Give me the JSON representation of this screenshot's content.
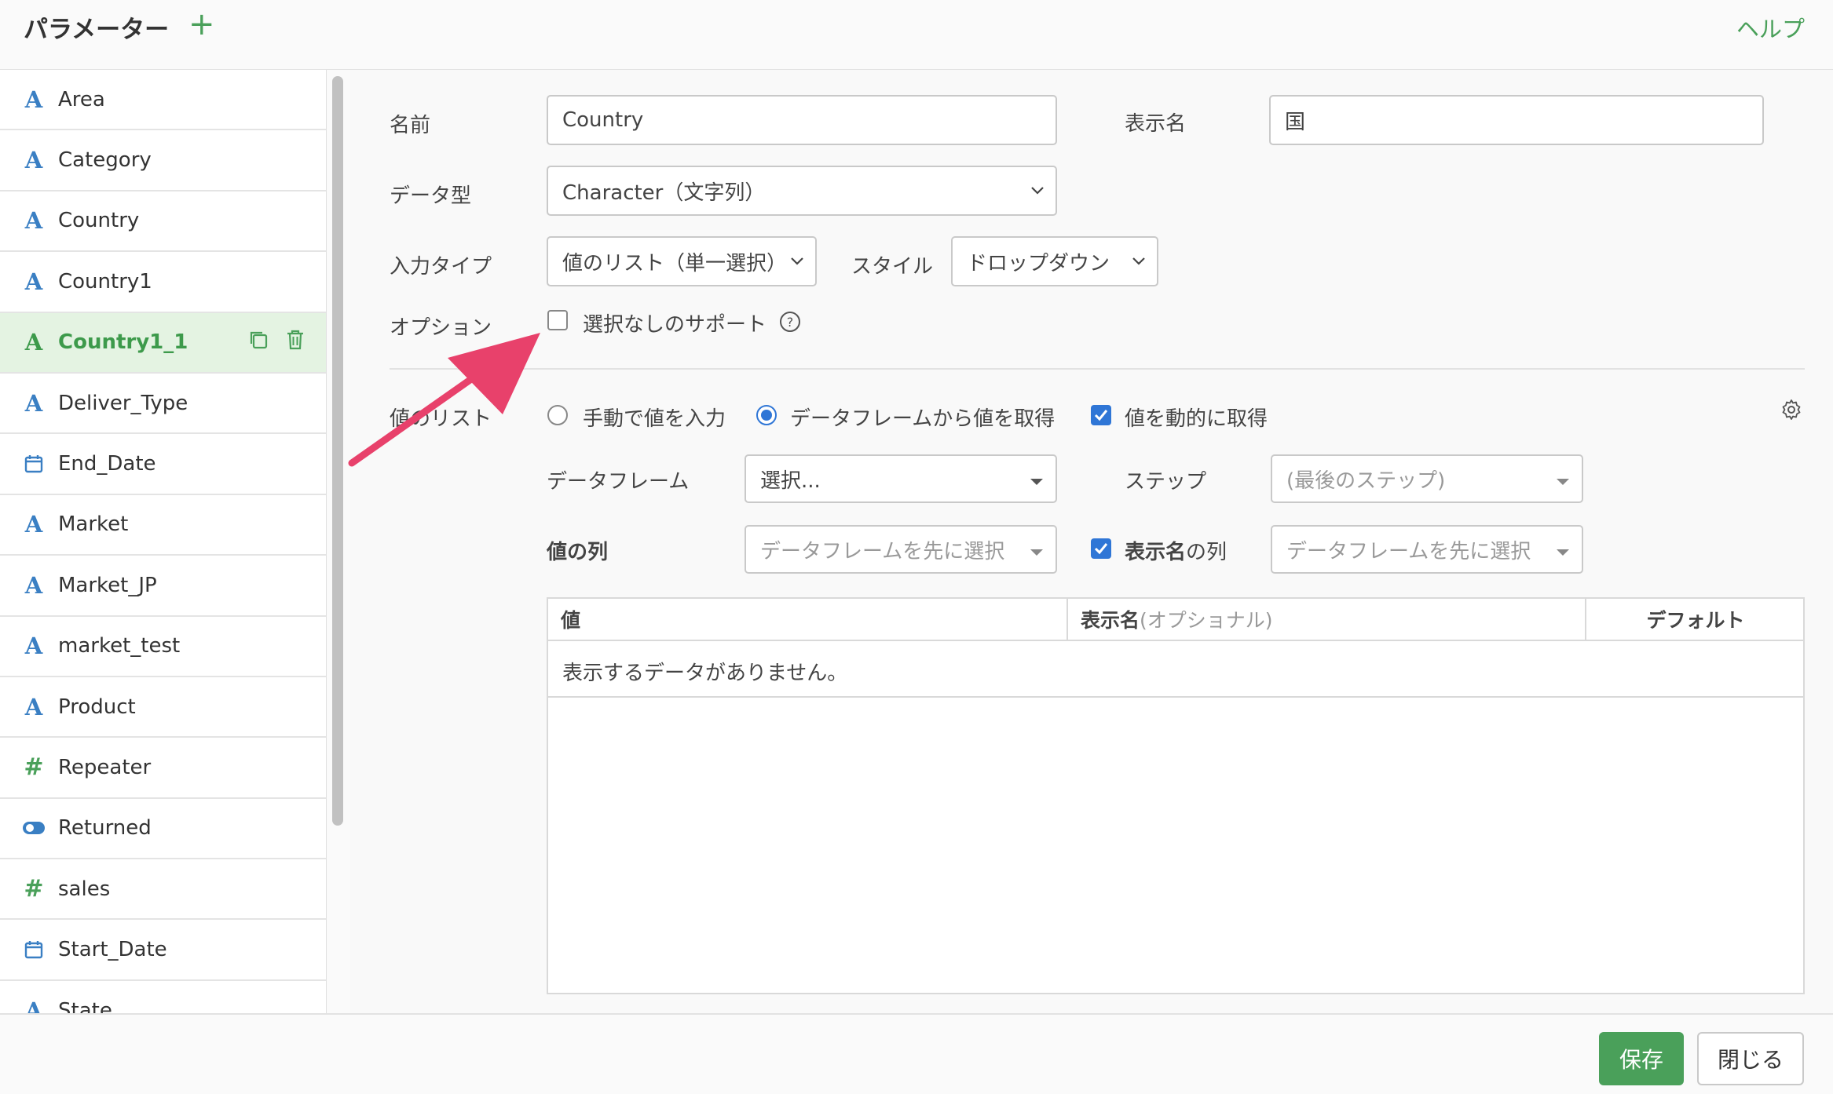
{
  "header": {
    "title": "パラメーター",
    "add_icon": "plus-icon",
    "help": "ヘルプ"
  },
  "sidebar": {
    "items": [
      {
        "label": "Area",
        "icon": "text-type-icon"
      },
      {
        "label": "Category",
        "icon": "text-type-icon"
      },
      {
        "label": "Country",
        "icon": "text-type-icon"
      },
      {
        "label": "Country1",
        "icon": "text-type-icon"
      },
      {
        "label": "Country1_1",
        "icon": "text-type-icon",
        "active": true
      },
      {
        "label": "Deliver_Type",
        "icon": "text-type-icon"
      },
      {
        "label": "End_Date",
        "icon": "calendar-icon"
      },
      {
        "label": "Market",
        "icon": "text-type-icon"
      },
      {
        "label": "Market_JP",
        "icon": "text-type-icon"
      },
      {
        "label": "market_test",
        "icon": "text-type-icon"
      },
      {
        "label": "Product",
        "icon": "text-type-icon"
      },
      {
        "label": "Repeater",
        "icon": "number-type-icon"
      },
      {
        "label": "Returned",
        "icon": "toggle-icon"
      },
      {
        "label": "sales",
        "icon": "number-type-icon"
      },
      {
        "label": "Start_Date",
        "icon": "calendar-icon"
      },
      {
        "label": "State",
        "icon": "text-type-icon"
      }
    ]
  },
  "form": {
    "name_label": "名前",
    "name_value": "Country",
    "display_label": "表示名",
    "display_value": "国",
    "datatype_label": "データ型",
    "datatype_value": "Character（文字列）",
    "inputtype_label": "入力タイプ",
    "inputtype_value": "値のリスト（単一選択）",
    "style_label": "スタイル",
    "style_value": "ドロップダウン",
    "option_label": "オプション",
    "option_text": "選択なしのサポート",
    "option_checked": false,
    "valuelist_label": "値のリスト",
    "radio_manual": "手動で値を入力",
    "radio_dataframe": "データフレームから値を取得",
    "radio_selected": "dataframe",
    "dynamic_label": "値を動的に取得",
    "dynamic_checked": true,
    "dataframe_label": "データフレーム",
    "dataframe_value": "選択...",
    "step_label": "ステップ",
    "step_placeholder": "(最後のステップ)",
    "valuecol_label": "値の列",
    "valuecol_placeholder": "データフレームを先に選択",
    "displaycol_label_bold": "表示名",
    "displaycol_label_rest": "の列",
    "displaycol_checked": true,
    "displaycol_placeholder": "データフレームを先に選択"
  },
  "table": {
    "col_value": "値",
    "col_display": "表示名",
    "col_display_note": " (オプショナル)",
    "col_default": "デフォルト",
    "empty": "表示するデータがありません。"
  },
  "footer": {
    "save": "保存",
    "close": "閉じる"
  },
  "colors": {
    "accent_green": "#4aa05a",
    "checkbox_blue": "#2f76d6",
    "annotation_arrow": "#e8416b"
  }
}
